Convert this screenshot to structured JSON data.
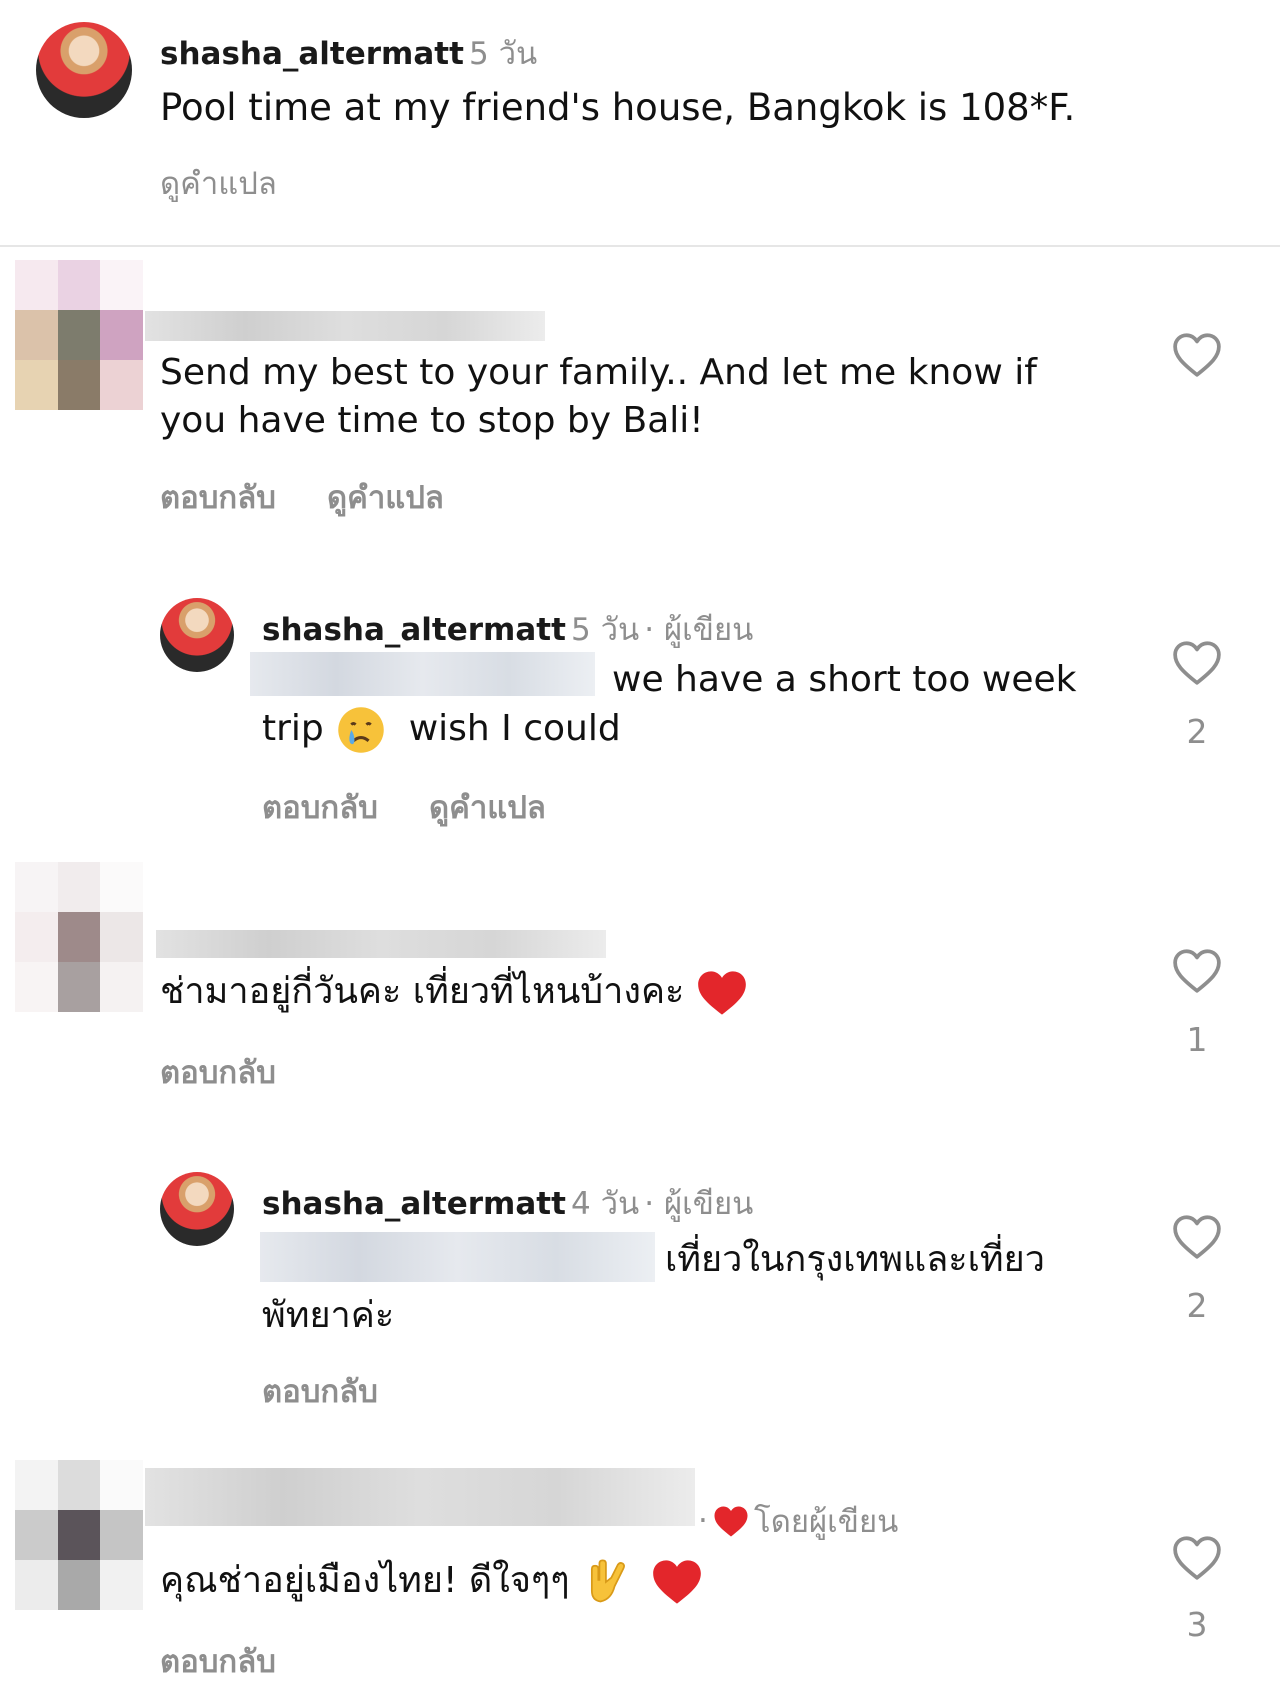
{
  "caption": {
    "username": "shasha_altermatt",
    "time": "5 วัน",
    "text": "Pool time at my friend's house, Bangkok is 108*F.",
    "translate": "ดูคำแปล"
  },
  "comments": [
    {
      "text_line1": "Send my best to your family.. And let me know if",
      "text_line2": "you have time to stop by Bali!",
      "reply": "ตอบกลับ",
      "translate": "ดูคำแปล"
    },
    {
      "username": "shasha_altermatt",
      "time": "5 วัน",
      "author_badge": "· ผู้เขียน",
      "text_line1": "we have a short too week",
      "text_line2_a": "trip",
      "text_line2_b": "wish I could",
      "reply": "ตอบกลับ",
      "translate": "ดูคำแปล",
      "likes": "2"
    },
    {
      "text": "ช่ามาอยู่กี่วันคะ เที่ยวที่ไหนบ้างคะ",
      "reply": "ตอบกลับ",
      "likes": "1"
    },
    {
      "username": "shasha_altermatt",
      "time": "4 วัน",
      "author_badge": "· ผู้เขียน",
      "text_line1": "เที่ยวในกรุงเทพและเที่ยว",
      "text_line2": "พัทยาค่ะ",
      "reply": "ตอบกลับ",
      "likes": "2"
    },
    {
      "liked_by_author": "โดยผู้เขียน",
      "text": "คุณช่าอยู่เมืองไทย! ดีใจๆๆ",
      "reply": "ตอบกลับ",
      "likes": "3"
    }
  ],
  "colors": {
    "heart_red": "#e3262b",
    "muted": "#8e8e8e"
  }
}
